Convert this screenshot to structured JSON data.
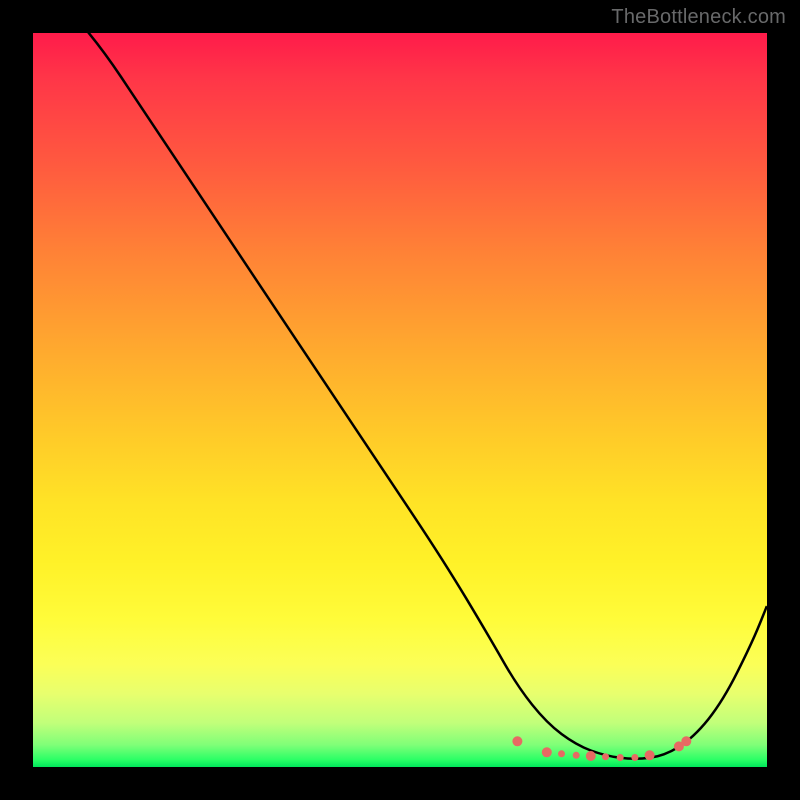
{
  "attribution": "TheBottleneck.com",
  "chart_data": {
    "type": "line",
    "title": "",
    "xlabel": "",
    "ylabel": "",
    "xlim": [
      0,
      100
    ],
    "ylim": [
      0,
      100
    ],
    "series": [
      {
        "name": "bottleneck-curve",
        "x": [
          0,
          8,
          16,
          24,
          32,
          40,
          48,
          56,
          62,
          66,
          70,
          74,
          78,
          82,
          86,
          90,
          94,
          98,
          100
        ],
        "values": [
          108,
          100,
          88,
          76,
          64,
          52,
          40,
          28,
          18,
          11,
          6,
          3,
          1.5,
          1,
          1.5,
          4,
          9,
          17,
          22
        ]
      }
    ],
    "markers": {
      "name": "optimal-range",
      "points": [
        {
          "x": 66,
          "y": 3.5,
          "r": 5
        },
        {
          "x": 70,
          "y": 2.0,
          "r": 5
        },
        {
          "x": 72,
          "y": 1.8,
          "r": 3.5
        },
        {
          "x": 74,
          "y": 1.6,
          "r": 3.5
        },
        {
          "x": 76,
          "y": 1.5,
          "r": 5
        },
        {
          "x": 78,
          "y": 1.4,
          "r": 3.5
        },
        {
          "x": 80,
          "y": 1.3,
          "r": 3.5
        },
        {
          "x": 82,
          "y": 1.3,
          "r": 3.5
        },
        {
          "x": 84,
          "y": 1.6,
          "r": 5
        },
        {
          "x": 88,
          "y": 2.8,
          "r": 5
        },
        {
          "x": 89,
          "y": 3.5,
          "r": 5
        }
      ]
    },
    "gradient_stops": [
      {
        "pos": 0,
        "color": "#ff1b4a"
      },
      {
        "pos": 50,
        "color": "#ffc829"
      },
      {
        "pos": 90,
        "color": "#e8ff6e"
      },
      {
        "pos": 100,
        "color": "#00e65b"
      }
    ]
  }
}
